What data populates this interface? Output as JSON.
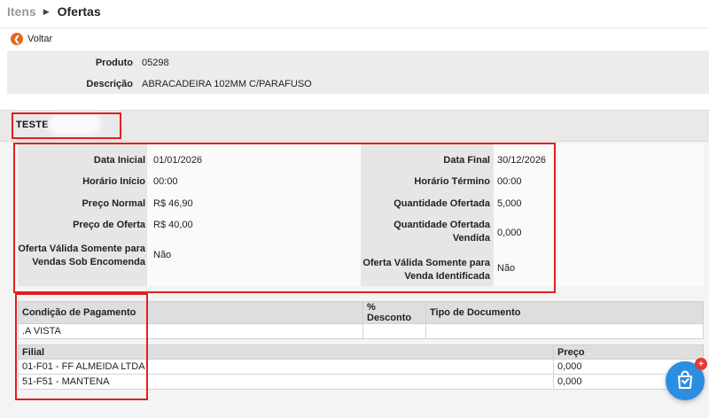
{
  "breadcrumb": {
    "parent": "Itens",
    "current": "Ofertas"
  },
  "back": {
    "label": "Voltar",
    "icon": "arrow-left-circle-icon"
  },
  "product": {
    "produto_label": "Produto",
    "produto_value": "05298",
    "descricao_label": "Descrição",
    "descricao_value": "ABRACADEIRA 102MM C/PARAFUSO"
  },
  "offer": {
    "title": "TESTE",
    "left": {
      "data_inicial_label": "Data Inicial",
      "data_inicial": "01/01/2026",
      "horario_inicio_label": "Horário Início",
      "horario_inicio": "00:00",
      "preco_normal_label": "Preço Normal",
      "preco_normal": "R$ 46,90",
      "preco_oferta_label": "Preço de Oferta",
      "preco_oferta": "R$ 40,00",
      "encomenda_label_1": "Oferta Válida Somente para",
      "encomenda_label_2": "Vendas Sob Encomenda",
      "encomenda": "Não"
    },
    "right": {
      "data_final_label": "Data Final",
      "data_final": "30/12/2026",
      "horario_termino_label": "Horário Término",
      "horario_termino": "00:00",
      "qtd_ofertada_label": "Quantidade Ofertada",
      "qtd_ofertada": "5,000",
      "qtd_vendida_label_1": "Quantidade Ofertada",
      "qtd_vendida_label_2": "Vendida",
      "qtd_vendida": "0,000",
      "identificada_label_1": "Oferta Válida Somente para",
      "identificada_label_2": "Venda Identificada",
      "identificada": "Não"
    }
  },
  "payment_table": {
    "headers": [
      "Condição de Pagamento",
      "% Desconto",
      "Tipo de Documento"
    ],
    "rows": [
      [
        ".A VISTA",
        "",
        ""
      ]
    ]
  },
  "branch_table": {
    "headers": [
      "Filial",
      "Preço"
    ],
    "rows": [
      [
        "01-F01 - FF ALMEIDA LTDA",
        "0,000"
      ],
      [
        "51-F51 - MANTENA",
        "0,000"
      ]
    ]
  },
  "fab": {
    "icon": "shopping-bag-icon",
    "badge": "+"
  },
  "colors": {
    "accent": "#e8661f",
    "fab": "#2b8ee0",
    "highlight": "#e02020",
    "badge": "#e53935"
  }
}
